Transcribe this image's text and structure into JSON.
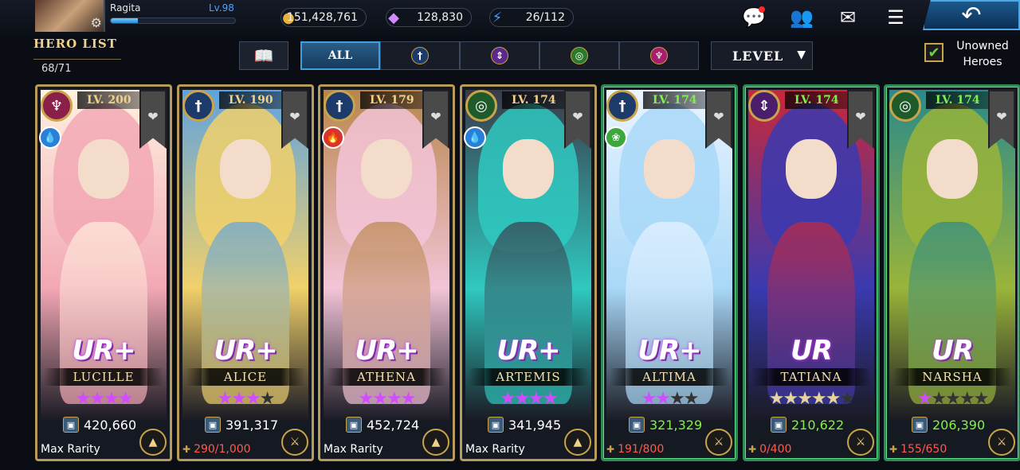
{
  "player": {
    "name": "Ragita",
    "level": "Lv.98",
    "xp_fraction": 0.22
  },
  "currencies": [
    {
      "icon": "gold-coin-icon",
      "value": "151,428,761"
    },
    {
      "icon": "crystal-icon",
      "value": "128,830"
    },
    {
      "icon": "stamina-bolt-icon",
      "value": "26/112"
    }
  ],
  "header": {
    "title": "HERO LIST",
    "count": "68/71"
  },
  "filters": {
    "all_label": "ALL",
    "sort_label": "LEVEL",
    "unowned_label": "Unowned Heroes",
    "unowned_checked": true
  },
  "colors": {
    "gold": "#c9a44a",
    "green_border": "#2f8a54",
    "accent_blue": "#3fa0e0"
  },
  "heroes": [
    {
      "name": "LUCILLE",
      "level": "LV. 200",
      "rarity": "UR+",
      "class_color": "#8a1f4a",
      "class_glyph": "♆",
      "element": "water",
      "element_color": "#2a7fd6",
      "element_glyph": "💧",
      "stars_filled": 4,
      "stars_total": 4,
      "star_color": "#d24cff",
      "power": "420,660",
      "bottom_text": "Max Rarity",
      "bottom_type": "max",
      "owned": true,
      "palette": [
        "#f2a8b4",
        "#fff1e0"
      ]
    },
    {
      "name": "ALICE",
      "level": "LV. 190",
      "rarity": "UR+",
      "class_color": "#1c3a6a",
      "class_glyph": "†",
      "element": "",
      "element_color": "",
      "element_glyph": "",
      "stars_filled": 3,
      "stars_total": 4,
      "star_color": "#d24cff",
      "power": "391,317",
      "bottom_text": "290/1,000",
      "bottom_type": "frag",
      "owned": true,
      "palette": [
        "#f1d06a",
        "#5ea3e0"
      ]
    },
    {
      "name": "ATHENA",
      "level": "LV. 179",
      "rarity": "UR+",
      "class_color": "#1c3a6a",
      "class_glyph": "†",
      "element": "fire",
      "element_color": "#d8342a",
      "element_glyph": "🔥",
      "stars_filled": 4,
      "stars_total": 4,
      "star_color": "#d24cff",
      "power": "452,724",
      "bottom_text": "Max Rarity",
      "bottom_type": "max",
      "owned": true,
      "palette": [
        "#f3c4d8",
        "#b8864a"
      ]
    },
    {
      "name": "ARTEMIS",
      "level": "LV. 174",
      "rarity": "UR+",
      "class_color": "#1e5a2a",
      "class_glyph": "◎",
      "element": "water",
      "element_color": "#2a7fd6",
      "element_glyph": "💧",
      "stars_filled": 4,
      "stars_total": 4,
      "star_color": "#d24cff",
      "power": "341,945",
      "bottom_text": "Max Rarity",
      "bottom_type": "max",
      "owned": true,
      "palette": [
        "#2fc9c0",
        "#3a3a4a"
      ]
    },
    {
      "name": "ALTIMA",
      "level": "LV. 174",
      "rarity": "UR+",
      "class_color": "#1c3a6a",
      "class_glyph": "†",
      "element": "wind",
      "element_color": "#3aa83a",
      "element_glyph": "❀",
      "stars_filled": 2,
      "stars_total": 4,
      "star_color": "#d24cff",
      "power": "321,329",
      "bottom_text": "191/800",
      "bottom_type": "frag",
      "owned": false,
      "palette": [
        "#a8d8f8",
        "#eaf4ff"
      ]
    },
    {
      "name": "TATIANA",
      "level": "LV. 174",
      "rarity": "UR",
      "class_color": "#4a1e6a",
      "class_glyph": "⇕",
      "element": "",
      "element_color": "",
      "element_glyph": "",
      "stars_filled": 5,
      "stars_total": 6,
      "star_color": "#e6d49a",
      "power": "210,622",
      "bottom_text": "0/400",
      "bottom_type": "frag",
      "owned": false,
      "palette": [
        "#3a3ab0",
        "#c8283a"
      ]
    },
    {
      "name": "NARSHA",
      "level": "LV. 174",
      "rarity": "UR",
      "class_color": "#1e5a2a",
      "class_glyph": "◎",
      "element": "",
      "element_color": "",
      "element_glyph": "",
      "stars_filled": 1,
      "stars_total": 5,
      "star_color": "#d24cff",
      "power": "206,390",
      "bottom_text": "155/650",
      "bottom_type": "frag",
      "owned": false,
      "palette": [
        "#9ab43a",
        "#2a8a8a"
      ]
    }
  ]
}
